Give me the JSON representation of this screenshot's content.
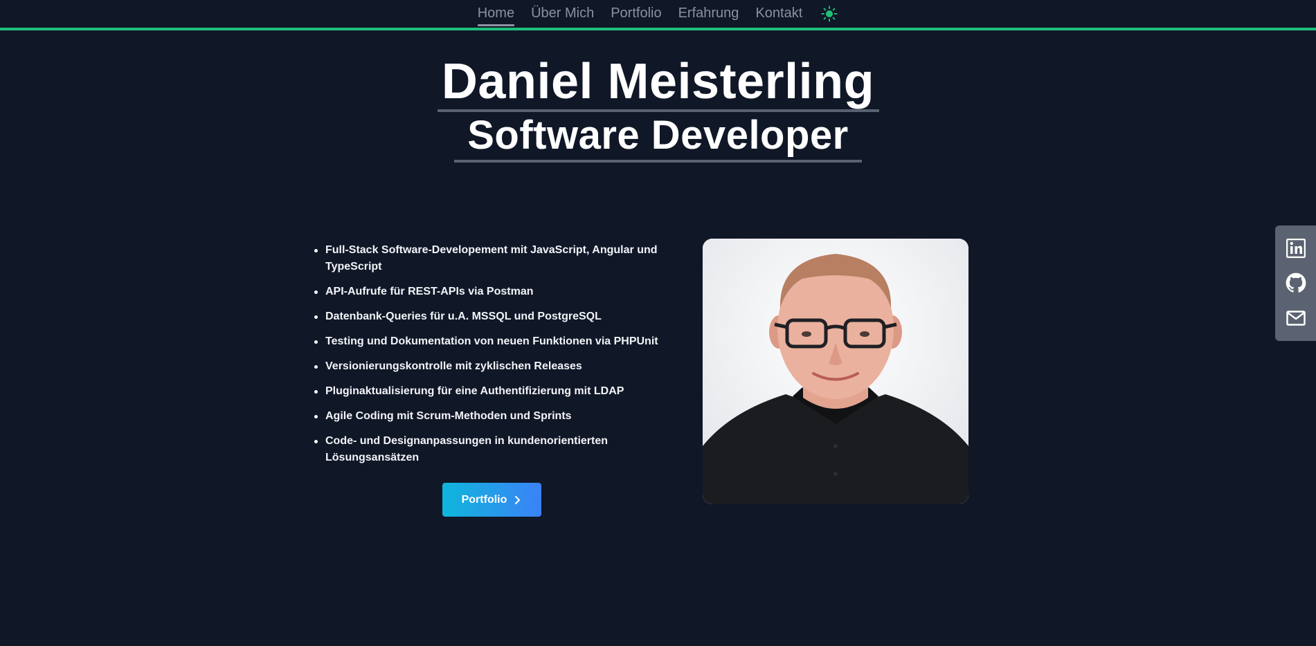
{
  "nav": {
    "items": [
      {
        "label": "Home",
        "active": true
      },
      {
        "label": "Über Mich",
        "active": false
      },
      {
        "label": "Portfolio",
        "active": false
      },
      {
        "label": "Erfahrung",
        "active": false
      },
      {
        "label": "Kontakt",
        "active": false
      }
    ],
    "theme_toggle_icon": "sun-icon"
  },
  "hero": {
    "name": "Daniel Meisterling",
    "role": "Software Developer"
  },
  "skills": [
    "Full-Stack Software-Developement mit JavaScript, Angular und TypeScript",
    "API-Aufrufe für REST-APIs via Postman",
    "Datenbank-Queries für u.A. MSSQL und PostgreSQL",
    "Testing und Dokumentation von neuen Funktionen via PHPUnit",
    "Versionierungskontrolle mit zyklischen Releases",
    "Pluginaktualisierung für eine Authentifizierung mit LDAP",
    "Agile Coding mit Scrum-Methoden und Sprints",
    "Code- und Designanpassungen in kundenorientierten Lösungsansätzen"
  ],
  "cta": {
    "label": "Portfolio",
    "icon": "chevron-right-icon"
  },
  "social": {
    "icons": [
      "linkedin-icon",
      "github-icon",
      "mail-icon"
    ]
  },
  "colors": {
    "background": "#101727",
    "accent": "#1fbf7a",
    "nav_text": "#8b919f",
    "rule": "#5a6170",
    "button_gradient_start": "#0fb6dc",
    "button_gradient_end": "#3b82f6",
    "social_bar": "#5b6271"
  }
}
